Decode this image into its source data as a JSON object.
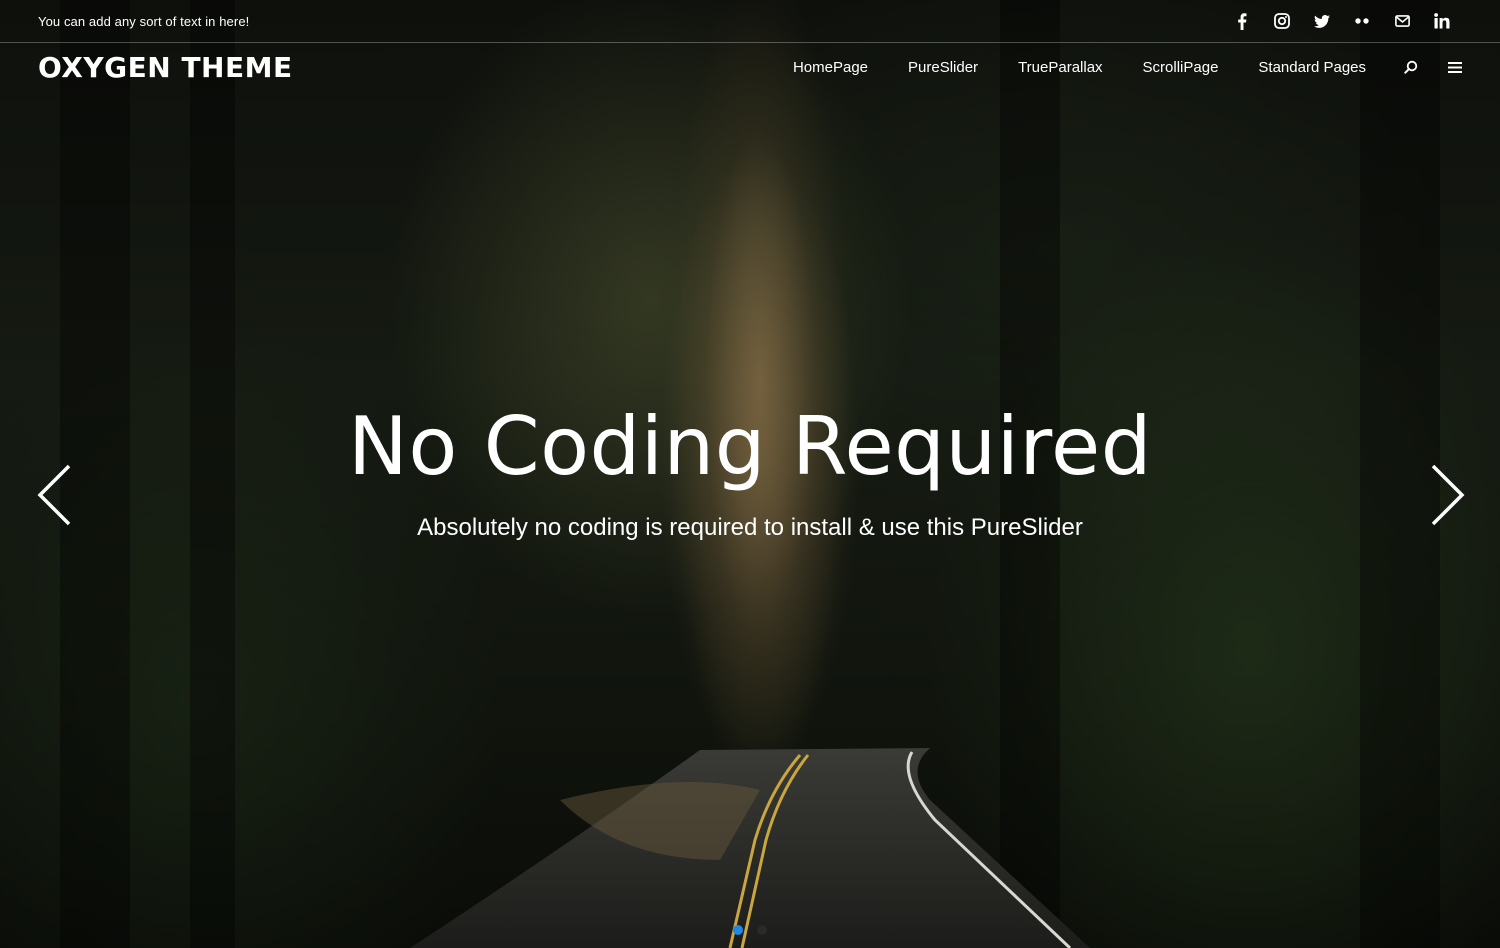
{
  "topbar": {
    "text": "You can add any sort of text in here!",
    "social_icons": [
      "facebook-icon",
      "instagram-icon",
      "twitter-icon",
      "flickr-icon",
      "mail-icon",
      "linkedin-icon"
    ]
  },
  "header": {
    "logo": "OXYGEN THEME",
    "nav": [
      "HomePage",
      "PureSlider",
      "TrueParallax",
      "ScrolliPage",
      "Standard Pages"
    ],
    "icons": [
      "search-icon",
      "hamburger-menu-icon"
    ]
  },
  "slider": {
    "title": "No Coding Required",
    "subtitle": "Absolutely no coding is required to install & use this PureSlider",
    "prev_icon": "chevron-left-icon",
    "next_icon": "chevron-right-icon",
    "active_slide": 1,
    "slide_count": 2
  },
  "colors": {
    "text": "#ffffff",
    "active_dot": "#1e88e5",
    "inactive_dot": "#2a2a2a"
  }
}
